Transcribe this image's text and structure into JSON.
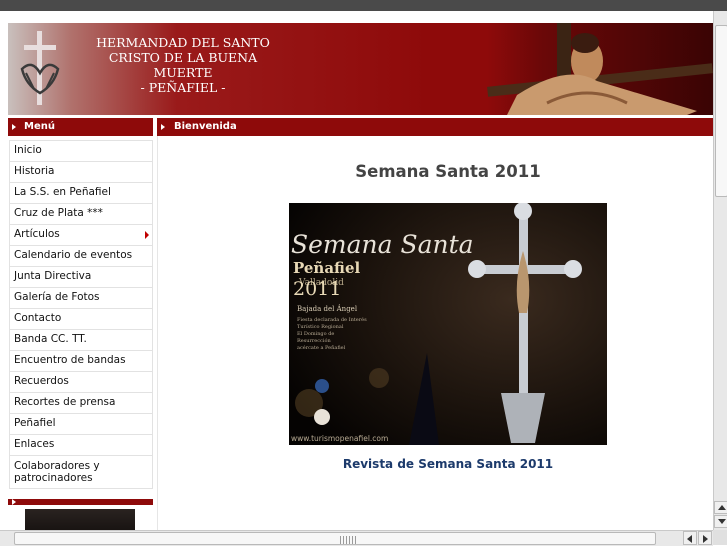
{
  "header": {
    "title_line1": "HERMANDAD DEL SANTO",
    "title_line2": "CRISTO DE LA BUENA MUERTE",
    "title_line3": "- PEÑAFIEL -"
  },
  "sidebar": {
    "menu_title": "Menú",
    "items": [
      {
        "label": "Inicio"
      },
      {
        "label": "Historia"
      },
      {
        "label": "La S.S. en Peñafiel"
      },
      {
        "label": "Cruz de Plata ***"
      },
      {
        "label": "Artículos"
      },
      {
        "label": "Calendario de eventos"
      },
      {
        "label": "Junta Directiva"
      },
      {
        "label": "Galería de Fotos"
      },
      {
        "label": "Contacto"
      },
      {
        "label": "Banda CC. TT."
      },
      {
        "label": "Encuentro de bandas"
      },
      {
        "label": "Recuerdos"
      },
      {
        "label": "Recortes de prensa"
      },
      {
        "label": "Peñafiel"
      },
      {
        "label": "Enlaces"
      },
      {
        "label": "Colaboradores y patrocinadores"
      }
    ]
  },
  "main": {
    "section_title": "Bienvenida",
    "heading": "Semana Santa 2011",
    "poster": {
      "title": "Semana Santa",
      "town": "Peñafiel",
      "province": "Valladolid",
      "year": "2011",
      "event": "Bajada del Ángel",
      "event_desc_1": "Fiesta declarada de Interés",
      "event_desc_2": "Turístico Regional",
      "event_desc_3": "El Domingo de",
      "event_desc_4": "Resurrección",
      "event_desc_5": "acércate a Peñafiel",
      "url": "www.turismopenafiel.com"
    },
    "link_label": "Revista de Semana Santa 2011"
  },
  "colors": {
    "brand_red": "#8e0a0a",
    "link_blue": "#1c3a6b"
  }
}
